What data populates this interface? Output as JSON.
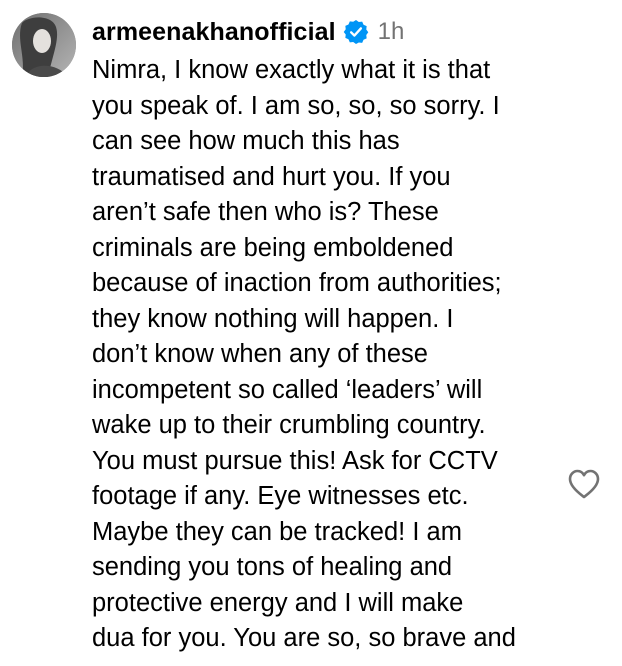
{
  "comment": {
    "username": "armeenakhanofficial",
    "time": "1h",
    "avatar_icon": "profile-photo",
    "verified_icon": "verified-badge-icon",
    "verified_color": "#0095f6",
    "like_icon": "heart-outline-icon",
    "lines": [
      "Nimra, I know exactly what it is that",
      "you speak of. I am so, so, so sorry. I",
      "can see how much this has",
      "traumatised and hurt you. If you",
      "aren’t safe then who is? These",
      "criminals are being emboldened",
      "because of inaction from authorities;",
      "they know nothing will happen. I",
      "don’t know when any of these",
      "incompetent so called ‘leaders’ will",
      "wake up to their crumbling country.",
      "You must pursue this! Ask for CCTV",
      "footage if any. Eye witnesses etc.",
      "Maybe they can be tracked! I am",
      "sending you tons of healing and",
      "protective energy and I will make",
      "dua for you. You are so, so brave and"
    ]
  }
}
